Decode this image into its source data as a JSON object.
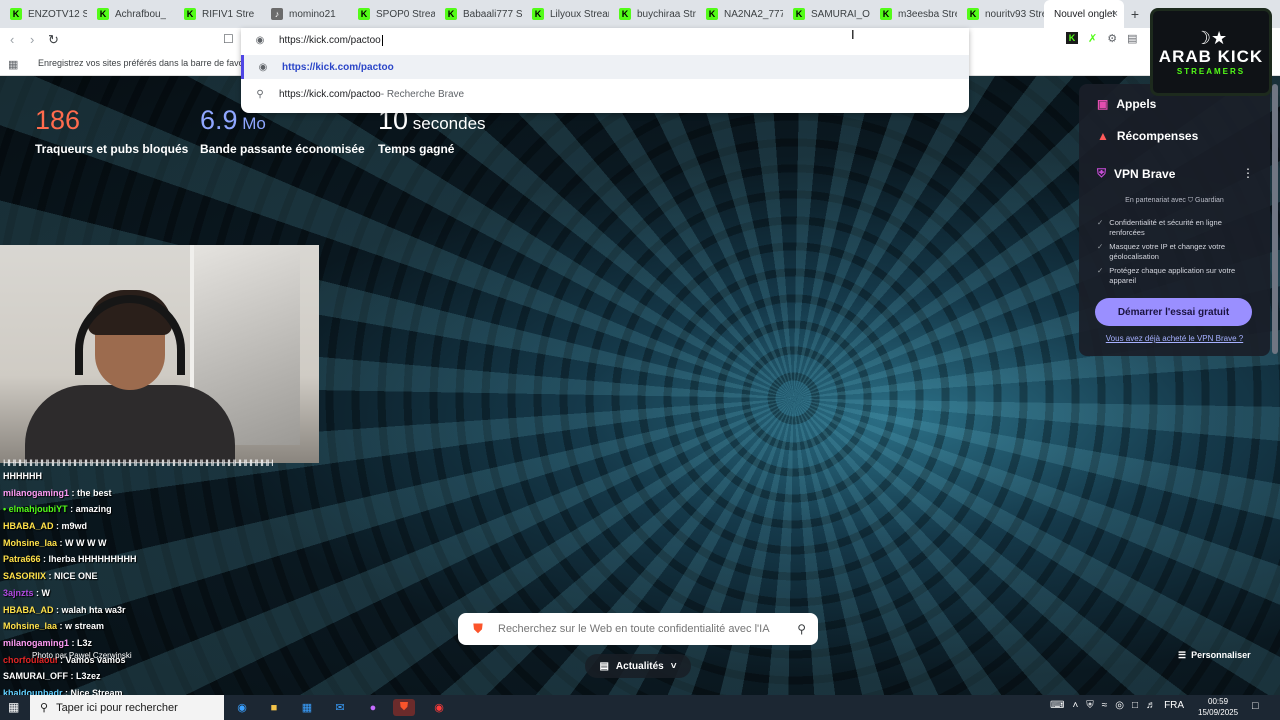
{
  "tabs": [
    {
      "label": "ENZOTV12 Stre",
      "fav": "K"
    },
    {
      "label": "Achrafbou_",
      "fav": "K"
    },
    {
      "label": "RIFIV1 Stre",
      "fav": "K"
    },
    {
      "label": "momino21",
      "fav": "speaker-icon"
    },
    {
      "label": "SPOP0 Strea",
      "fav": "K"
    },
    {
      "label": "Babaali777 Stre",
      "fav": "K"
    },
    {
      "label": "Lilyoux Stream",
      "fav": "K"
    },
    {
      "label": "buychiraa Strea",
      "fav": "K"
    },
    {
      "label": "NA2NA2_777 S",
      "fav": "K"
    },
    {
      "label": "SAMURAI_OFF",
      "fav": "K"
    },
    {
      "label": "m3eesba Strea",
      "fav": "K"
    },
    {
      "label": "nouritv93 Strea",
      "fav": "K"
    }
  ],
  "active_tab": {
    "label": "Nouvel onglet",
    "close": "×"
  },
  "new_tab_symbol": "+",
  "bookmarks_hint": "Enregistrez vos sites préférés dans la barre de favoris pour",
  "omnibox": {
    "input": "https://kick.com/pactoo",
    "suggestion_url": "https://kick.com/pactoo",
    "search_query": "https://kick.com/pactoo",
    "search_suffix": " - Recherche Brave"
  },
  "stats": {
    "trackers": {
      "value": "186",
      "caption": "Traqueurs et pubs bloqués"
    },
    "bandwidth": {
      "value": "6.9",
      "unit": " Mo",
      "caption": "Bande passante économisée"
    },
    "time": {
      "value": "10",
      "unit": " secondes",
      "caption": "Temps gagné"
    }
  },
  "side_panel": {
    "appels": "Appels",
    "recompenses": "Récompenses",
    "vpn": "VPN Brave",
    "vpn_partner": "En partenariat avec ⛉ Guardian",
    "features": [
      "Confidentialité et sécurité en ligne renforcées",
      "Masquez votre IP et changez votre géolocalisation",
      "Protégez chaque application sur votre appareil"
    ],
    "cta": "Démarrer l'essai gratuit",
    "link": "Vous avez déjà acheté le VPN Brave ?"
  },
  "logo": {
    "line1": "ARAB KICK",
    "line2": "STREAMERS"
  },
  "chat": {
    "separator": "ННННННННННННННННННННННННННННННННННННННННННННННННН",
    "lines": [
      {
        "user": "HHHHHH",
        "msg": "",
        "color": "#ffffff"
      },
      {
        "user": "milanogaming1",
        "msg": " : the best",
        "color": "#ff9cf5"
      },
      {
        "user": "• elmahjoubiYT",
        "msg": " : amazing",
        "color": "#53fc18"
      },
      {
        "user": "HBABA_AD",
        "msg": " : m9wd",
        "color": "#ffe14a"
      },
      {
        "user": "Mohsine_laa",
        "msg": " : W W W W",
        "color": "#ffe14a"
      },
      {
        "user": "Patra666",
        "msg": " : lherba HHHHHHHHH",
        "color": "#ffe14a"
      },
      {
        "user": "SASORIIX",
        "msg": " : NICE ONE",
        "color": "#ffe14a"
      },
      {
        "user": "3ajnzts",
        "msg": " : W",
        "color": "#b04ae0"
      },
      {
        "user": "HBABA_AD",
        "msg": " : walah hta wa3r",
        "color": "#ffe14a"
      },
      {
        "user": "Mohsine_laa",
        "msg": " : w stream",
        "color": "#ffe14a"
      },
      {
        "user": "milanogaming1",
        "msg": " : L3z",
        "color": "#ff9cf5"
      },
      {
        "user": "chorfoulaoul",
        "msg": " : Vamos vamos",
        "color": "#e02525"
      },
      {
        "user": "SAMURAI_OFF",
        "msg": " : L3zez",
        "color": "#ffffff"
      },
      {
        "user": "khaldounbadr",
        "msg": " : Nice Stream",
        "color": "#63d0ff"
      }
    ]
  },
  "photo_credit": "Photo par Pawel Czerwinski",
  "search": {
    "placeholder": "Recherchez sur le Web en toute confidentialité avec l'IA"
  },
  "news_label": "Actualités",
  "customize_label": "Personnaliser",
  "taskbar": {
    "search_text": "Taper ici pour rechercher",
    "lang": "FRA",
    "time": "00:59",
    "date": "15/09/2025"
  }
}
